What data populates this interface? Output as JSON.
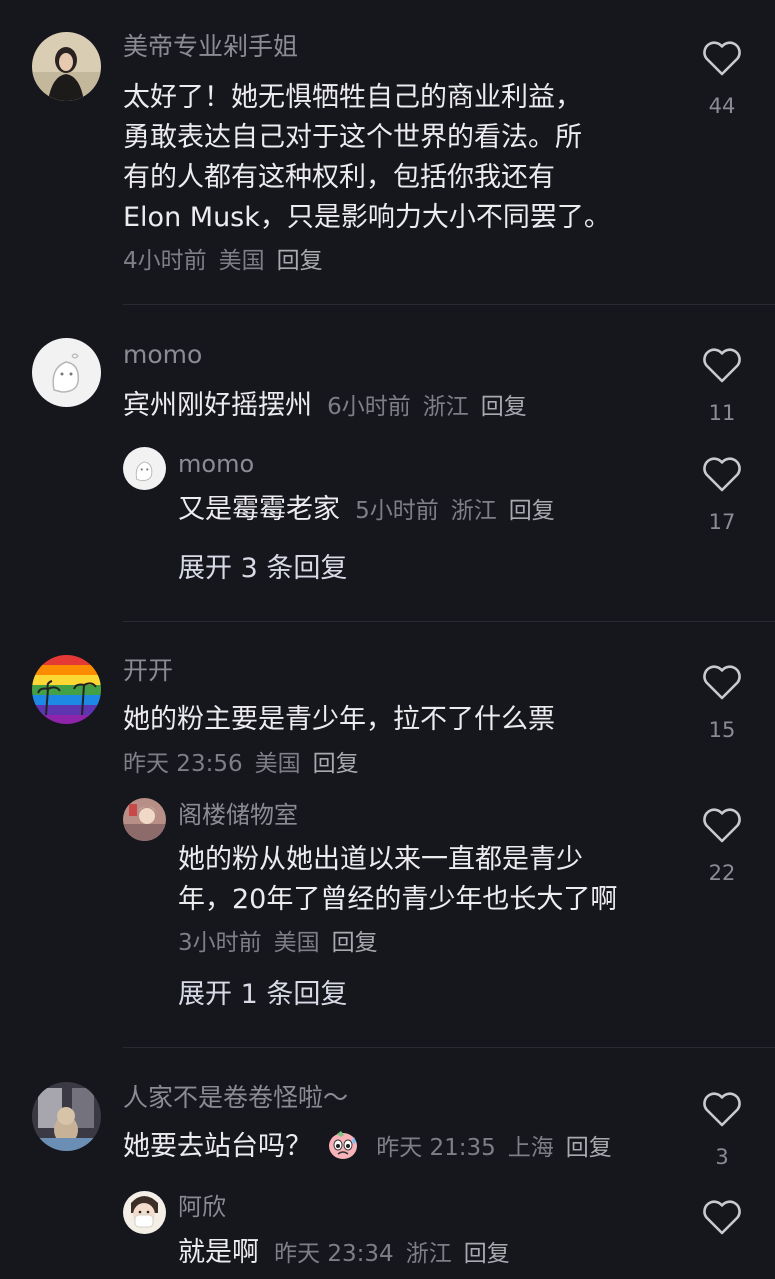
{
  "comments": [
    {
      "user": "美帝专业剁手姐",
      "lines": [
        "太好了！她无惧牺牲自己的商业利益，",
        "勇敢表达自己对于这个世界的看法。所",
        "有的人都有这种权利，包括你我还有",
        "Elon Musk，只是影响力大小不同罢了。"
      ],
      "time": "4小时前",
      "location": "美国",
      "reply": "回复",
      "likes": "44"
    },
    {
      "user": "momo",
      "text": "宾州刚好摇摆州",
      "time": "6小时前",
      "location": "浙江",
      "reply": "回复",
      "likes": "11",
      "sub": {
        "user": "momo",
        "text": "又是霉霉老家",
        "time": "5小时前",
        "location": "浙江",
        "reply": "回复",
        "likes": "17"
      },
      "expand": "展开 3 条回复"
    },
    {
      "user": "开开",
      "text": "她的粉主要是青少年，拉不了什么票",
      "time": "昨天 23:56",
      "location": "美国",
      "reply": "回复",
      "likes": "15",
      "sub": {
        "user": "阁楼储物室",
        "lines": [
          "她的粉从她出道以来一直都是青少",
          "年，20年了曾经的青少年也长大了啊"
        ],
        "time": "3小时前",
        "location": "美国",
        "reply": "回复",
        "likes": "22"
      },
      "expand": "展开 1 条回复"
    },
    {
      "user": "人家不是卷卷怪啦～",
      "text": "她要去站台吗？",
      "emoji": "sweat-face-emoji",
      "time": "昨天 21:35",
      "location": "上海",
      "reply": "回复",
      "likes": "3",
      "sub": {
        "user": "阿欣",
        "text": "就是啊",
        "time": "昨天 23:34",
        "location": "浙江",
        "reply": "回复",
        "likes": ""
      }
    }
  ],
  "colors": {
    "background": "#16161d",
    "text": "#ececef",
    "meta": "#7e7e86",
    "expand": "#d8dbe6"
  }
}
